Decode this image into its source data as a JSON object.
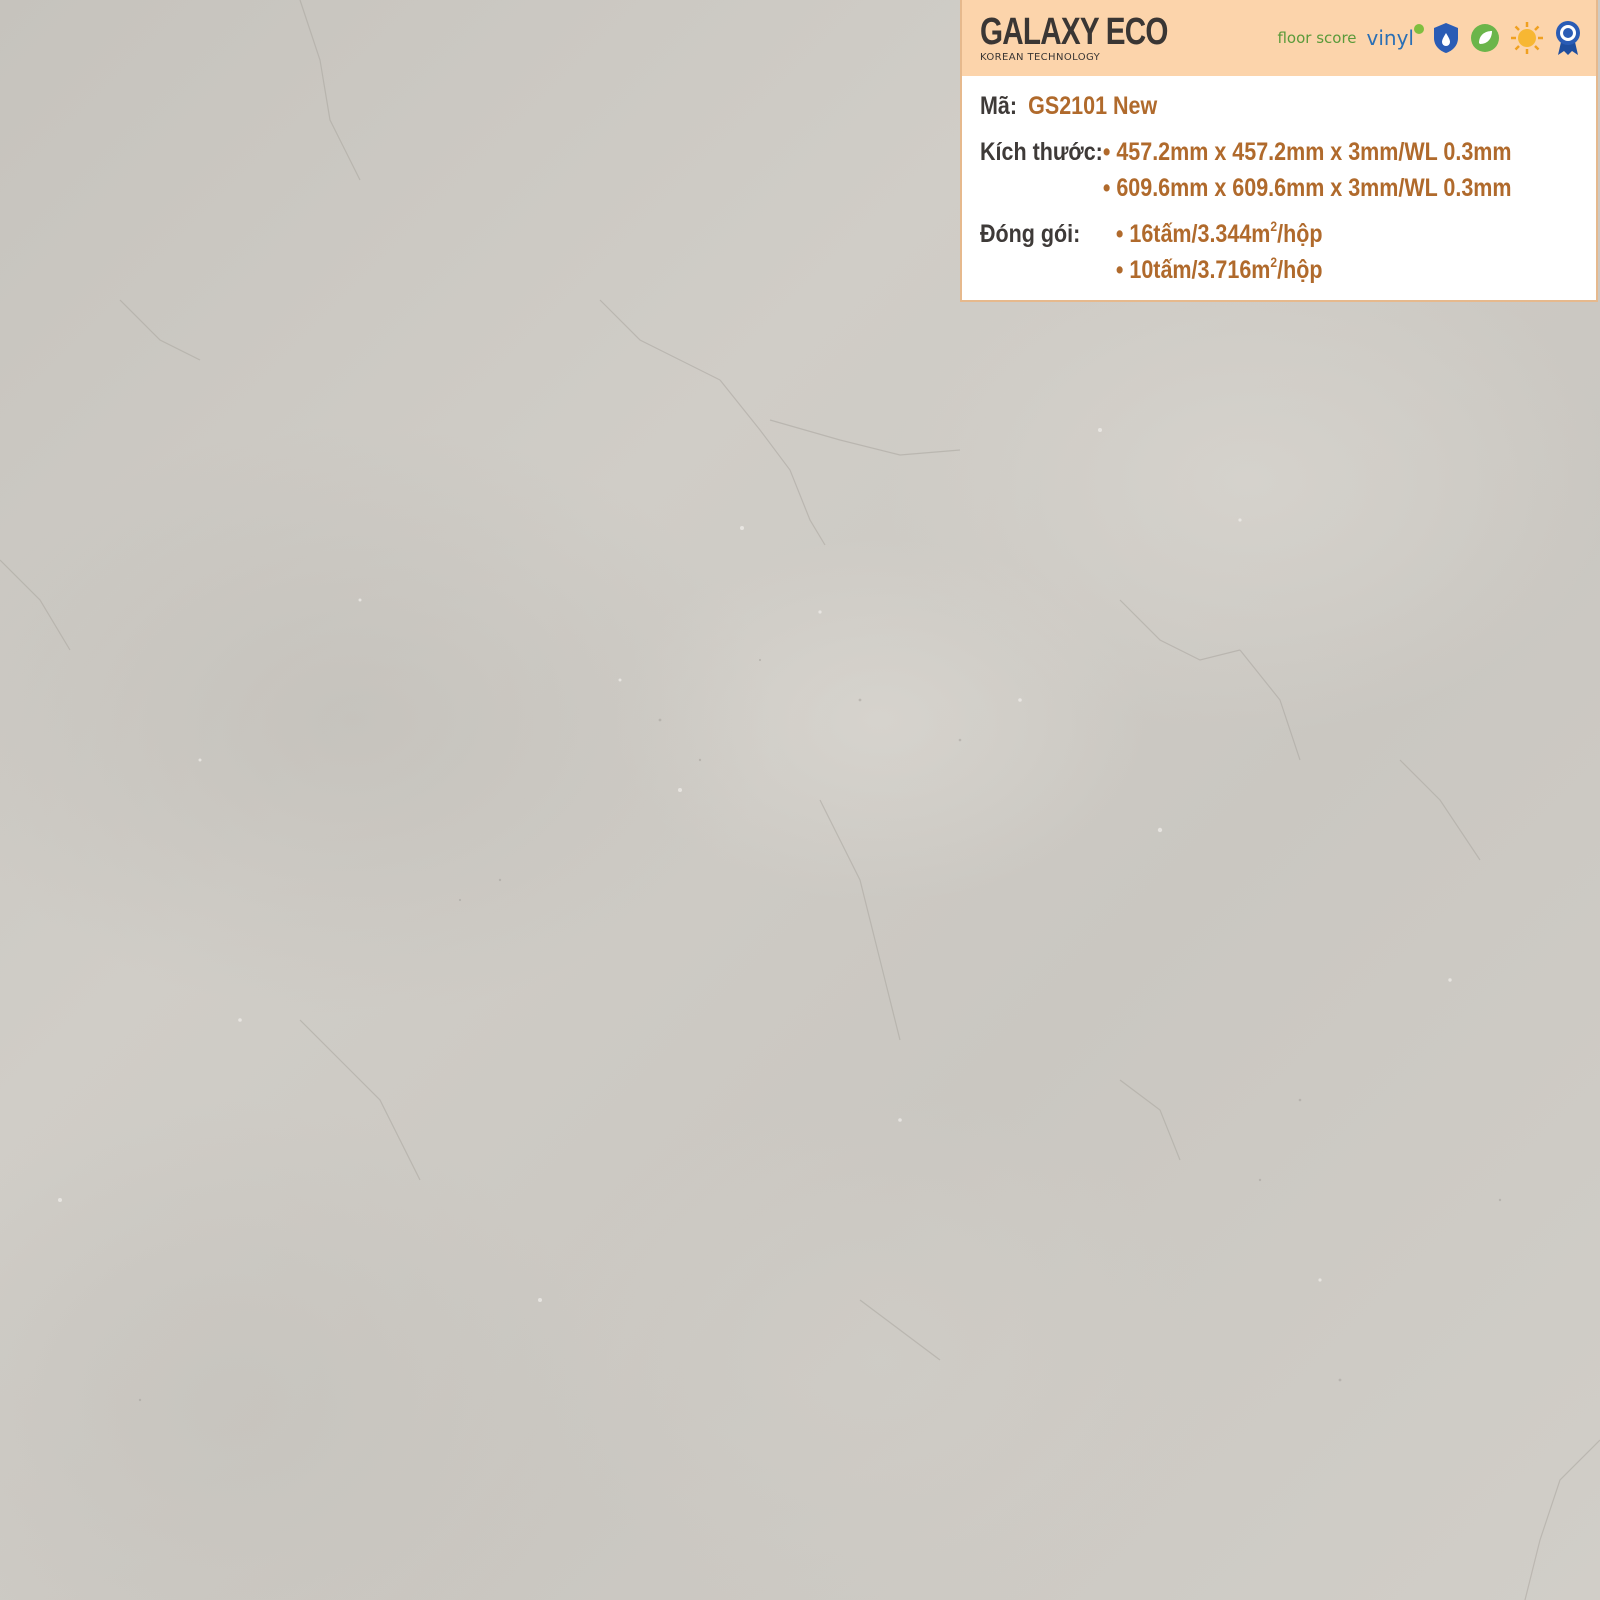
{
  "brand": {
    "name": "GALAXY ECO",
    "tagline": "KOREAN TECHNOLOGY"
  },
  "badges": [
    {
      "name": "floorscore",
      "text": "floor score",
      "small": "",
      "color": "#5a9a3a"
    },
    {
      "name": "vinyl",
      "text": "vinyl",
      "color": "#2a6fb5"
    },
    {
      "name": "waterproof-icon",
      "color": "#2a5cb5"
    },
    {
      "name": "eco-leaf-icon",
      "color": "#6bb54a"
    },
    {
      "name": "uv-sun-icon",
      "color": "#f0a020"
    },
    {
      "name": "iso-medal-icon",
      "color": "#2a5cb5"
    }
  ],
  "product": {
    "code_label": "Mã:",
    "code_value": "GS2101 New",
    "size_label": "Kích thước:",
    "sizes": [
      "• 457.2mm x 457.2mm x 3mm/WL 0.3mm",
      "• 609.6mm x 609.6mm x 3mm/WL 0.3mm"
    ],
    "pack_label": "Đóng gói:",
    "packs": [
      {
        "prefix": "• 16tấm/3.344m",
        "sup": "2",
        "suffix": "/hộp"
      },
      {
        "prefix": "• 10tấm/3.716m",
        "sup": "2",
        "suffix": "/hộp"
      }
    ]
  },
  "colors": {
    "header_bg": "#fcd4ab",
    "accent": "#b06a2c",
    "label": "#3e3a38",
    "stone": "#cdcac4"
  }
}
